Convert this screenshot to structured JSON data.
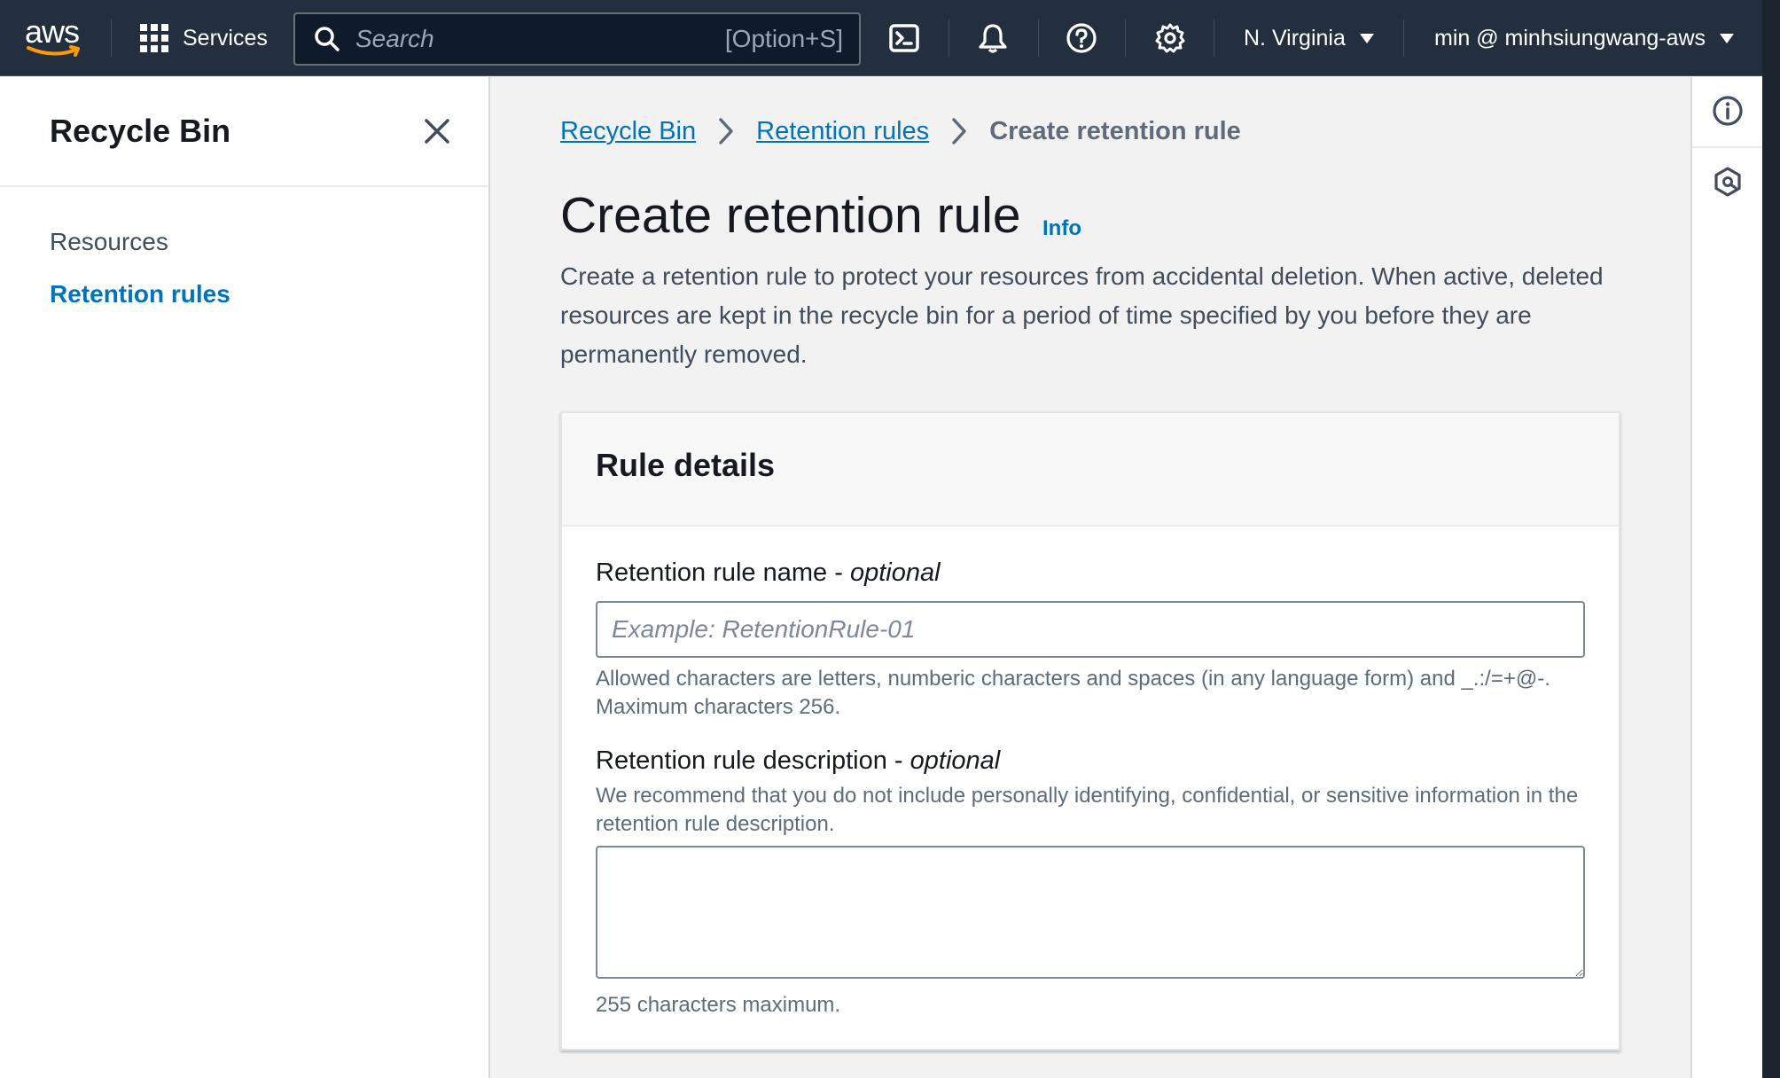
{
  "topnav": {
    "logo_text": "aws",
    "services_label": "Services",
    "search": {
      "placeholder": "Search",
      "shortcut": "[Option+S]"
    },
    "icons": [
      "cloudshell-icon",
      "notifications-icon",
      "help-icon",
      "settings-icon"
    ],
    "region": "N. Virginia",
    "account": "min @ minhsiungwang-aws"
  },
  "sidebar": {
    "title": "Recycle Bin",
    "items": [
      {
        "label": "Resources",
        "active": false
      },
      {
        "label": "Retention rules",
        "active": true
      }
    ]
  },
  "breadcrumb": {
    "items": [
      "Recycle Bin",
      "Retention rules"
    ],
    "current": "Create retention rule"
  },
  "page": {
    "title": "Create retention rule",
    "info_label": "Info",
    "description": "Create a retention rule to protect your resources from accidental deletion. When active, deleted resources are kept in the recycle bin for a period of time specified by you before they are permanently removed."
  },
  "panel": {
    "title": "Rule details",
    "name_field": {
      "label": "Retention rule name - ",
      "optional": "optional",
      "value": "",
      "placeholder": "Example: RetentionRule-01",
      "hint": "Allowed characters are letters, numberic characters and spaces (in any language form) and _.:/=+@-. Maximum characters 256."
    },
    "description_field": {
      "label": "Retention rule description - ",
      "optional": "optional",
      "hint": "We recommend that you do not include personally identifying, confidential, or sensitive information in the retention rule description.",
      "value": "",
      "constraint": "255 characters maximum."
    }
  },
  "tools": [
    "info-panel-icon",
    "security-hub-icon"
  ],
  "colors": {
    "nav_bg": "#232f3e",
    "link": "#0073bb",
    "accent_orange": "#ff9900"
  }
}
